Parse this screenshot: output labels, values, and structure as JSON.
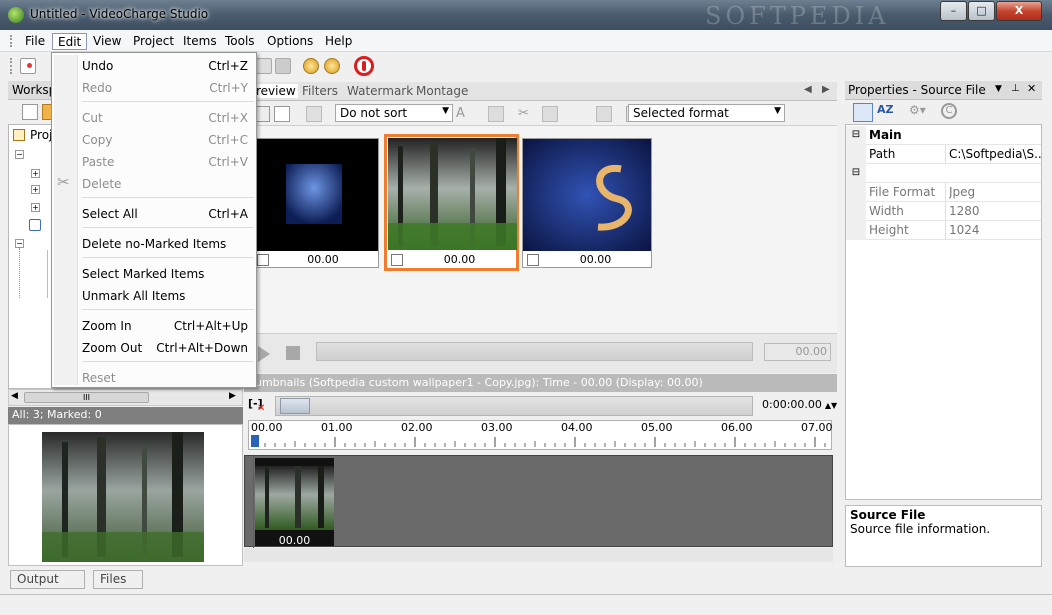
{
  "window": {
    "title": "Untitled - VideoCharge Studio",
    "watermark": "SOFTPEDIA",
    "min": "–",
    "max": "□",
    "close": "X"
  },
  "menubar": [
    "File",
    "Edit",
    "View",
    "Project",
    "Items",
    "Tools",
    "Options",
    "Help"
  ],
  "edit_menu": {
    "undo": {
      "label": "Undo",
      "shortcut": "Ctrl+Z"
    },
    "redo": {
      "label": "Redo",
      "shortcut": "Ctrl+Y"
    },
    "cut": {
      "label": "Cut",
      "shortcut": "Ctrl+X"
    },
    "copy": {
      "label": "Copy",
      "shortcut": "Ctrl+C"
    },
    "paste": {
      "label": "Paste",
      "shortcut": "Ctrl+V"
    },
    "delete": {
      "label": "Delete"
    },
    "select_all": {
      "label": "Select All",
      "shortcut": "Ctrl+A"
    },
    "delete_no_marked": {
      "label": "Delete no-Marked Items"
    },
    "select_marked": {
      "label": "Select Marked Items"
    },
    "unmark_all": {
      "label": "Unmark All Items"
    },
    "zoom_in": {
      "label": "Zoom In",
      "shortcut": "Ctrl+Alt+Up"
    },
    "zoom_out": {
      "label": "Zoom Out",
      "shortcut": "Ctrl+Alt+Down"
    },
    "reset": {
      "label": "Reset"
    }
  },
  "left": {
    "workspace_title": "Worksp",
    "tree_root": "Proj",
    "scroll_grip": "III",
    "status": "All: 3; Marked: 0",
    "tabs": {
      "output": "Output",
      "files": "Files"
    }
  },
  "center": {
    "tabs": {
      "preview": "review",
      "filters": "Filters",
      "watermark": "Watermark",
      "montage": "Montage"
    },
    "sort_select": "Do not sort",
    "format_select": "Selected format",
    "thumbs": [
      "00.00",
      "00.00",
      "00.00"
    ],
    "player_time": "00.00",
    "thumb_status": "humbnails (Softpedia custom wallpaper1 - Copy.jpg): Time - 00.00 (Display: 00.00)",
    "timeline_time": "0:00:00.00",
    "ruler": [
      "00.00",
      "01.00",
      "02.00",
      "03.00",
      "04.00",
      "05.00",
      "06.00",
      "07.00"
    ],
    "track_label": "00.00"
  },
  "properties": {
    "title": "Properties - Source File",
    "group_main": "Main",
    "rows": [
      {
        "name": "Path",
        "value": "C:\\Softpedia\\S..."
      },
      {
        "name": "File Format",
        "value": "Jpeg"
      },
      {
        "name": "Width",
        "value": "1280"
      },
      {
        "name": "Height",
        "value": "1024"
      }
    ],
    "desc_title": "Source File",
    "desc_text": "Source file information."
  }
}
